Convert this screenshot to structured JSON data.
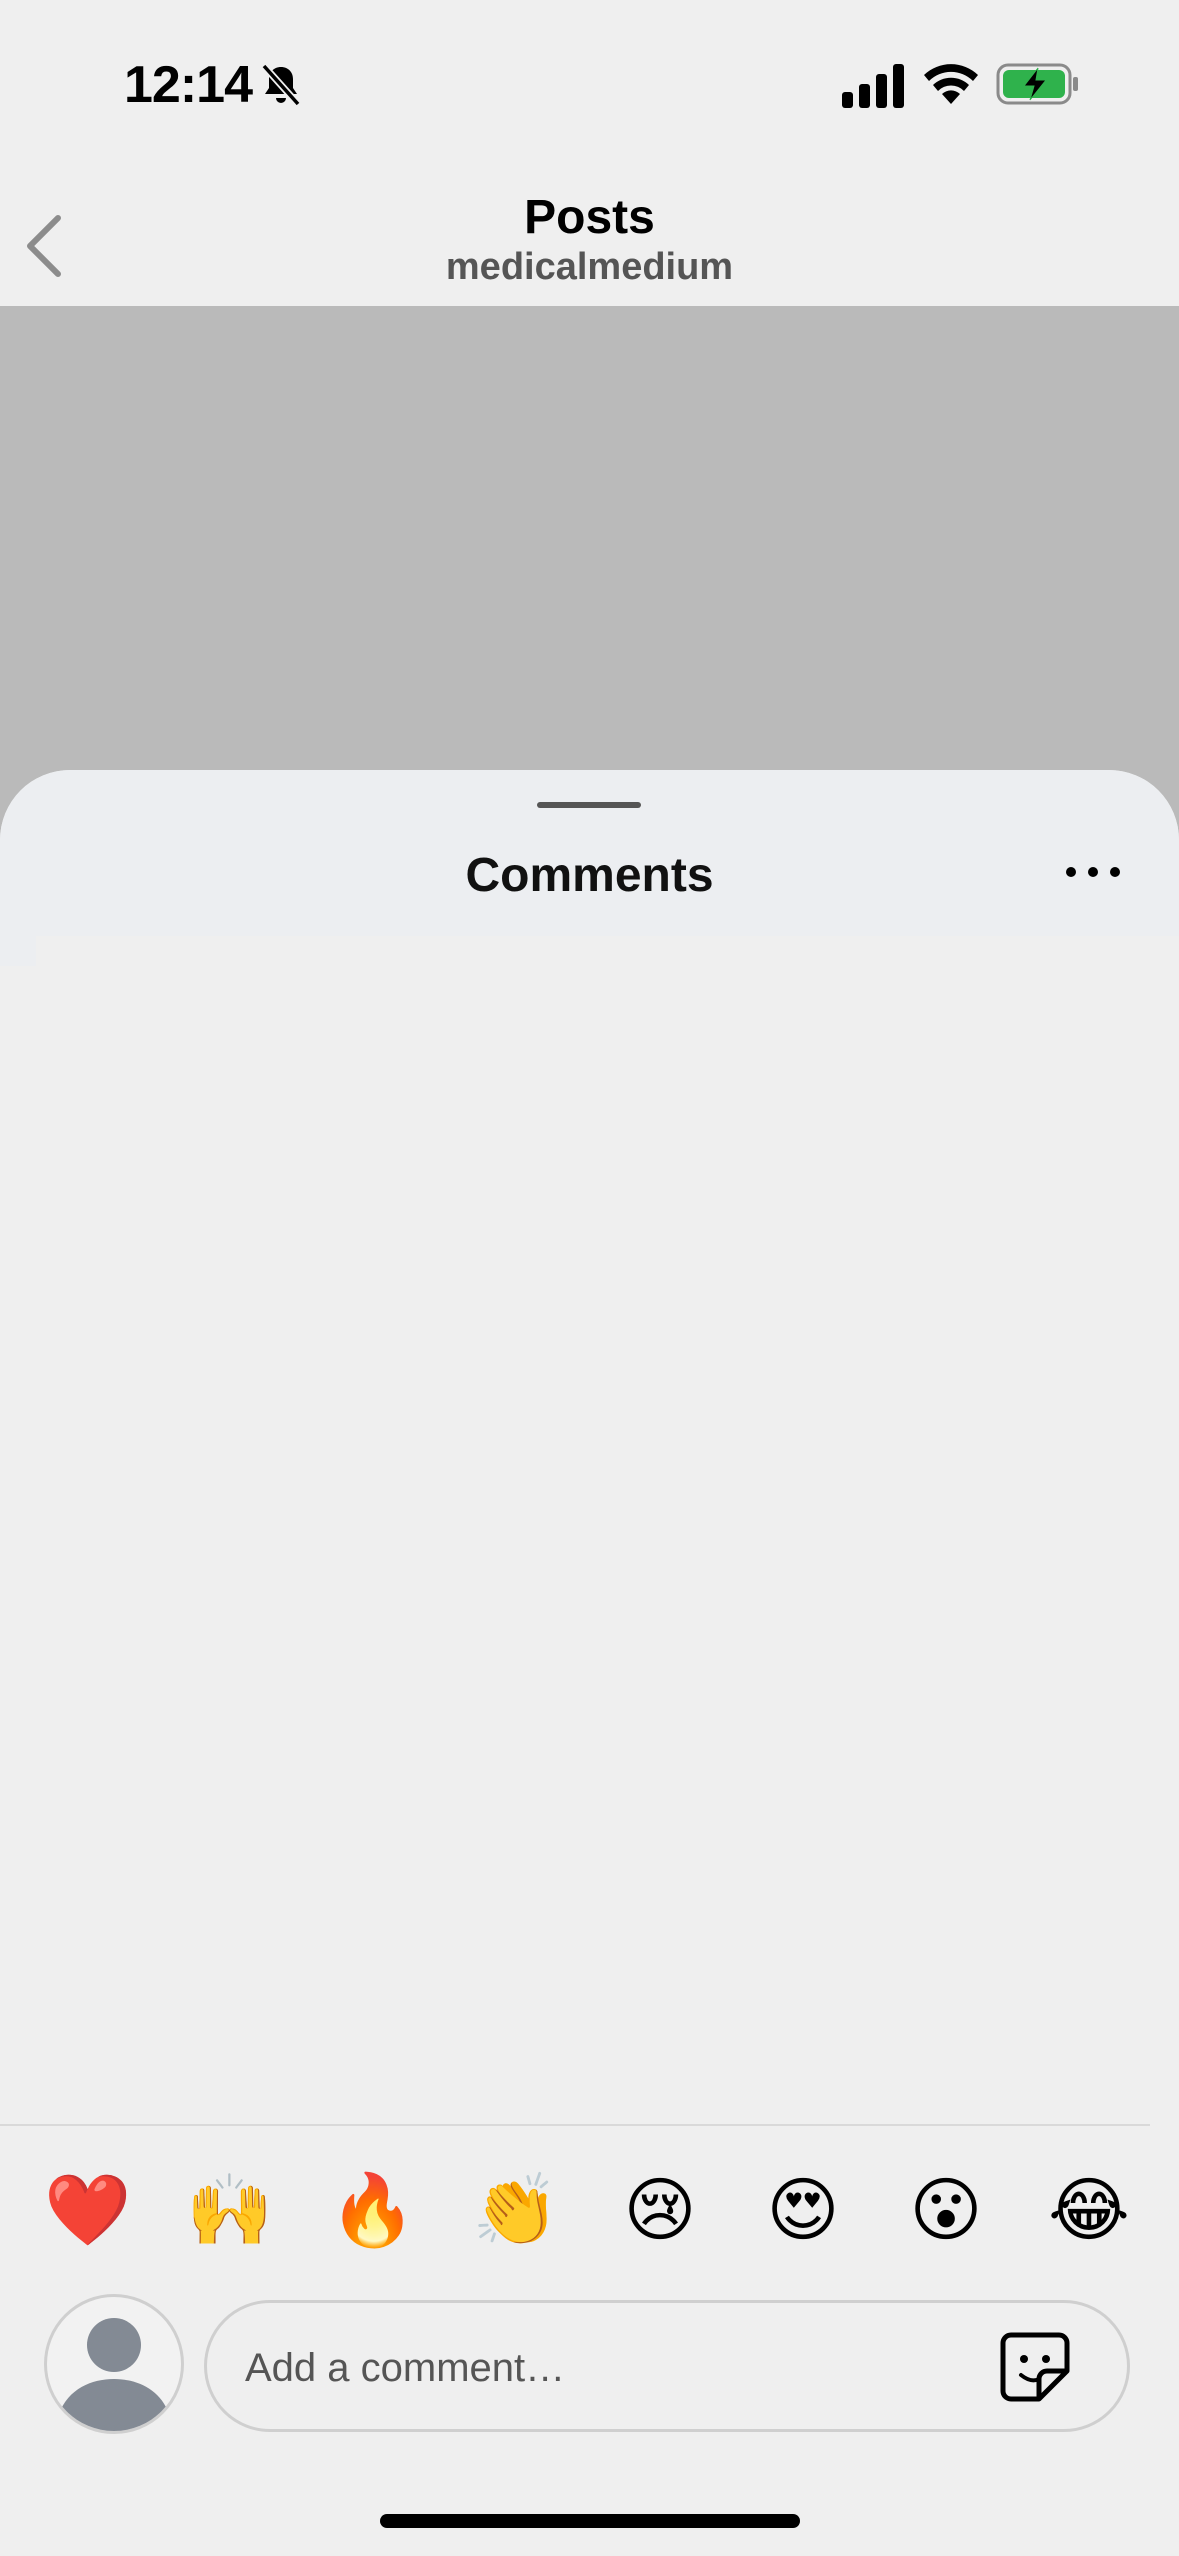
{
  "status_bar": {
    "time": "12:14",
    "icons": [
      "bell-slash-icon",
      "cellular-signal-icon",
      "wifi-icon",
      "battery-charging-icon"
    ],
    "battery_color": "#2fb24c"
  },
  "header": {
    "title": "Posts",
    "subtitle": "medicalmedium",
    "back_icon": "chevron-left-icon"
  },
  "sheet": {
    "title": "Comments",
    "more_icon": "more-horizontal-icon"
  },
  "emoji_bar": [
    {
      "name": "red-heart",
      "glyph": "❤️"
    },
    {
      "name": "raising-hands",
      "glyph": "🙌"
    },
    {
      "name": "fire",
      "glyph": "🔥"
    },
    {
      "name": "clapping-hands",
      "glyph": "👏"
    },
    {
      "name": "crying-face",
      "glyph": "😢"
    },
    {
      "name": "heart-eyes",
      "glyph": "😍"
    },
    {
      "name": "surprised-face",
      "glyph": "😮"
    },
    {
      "name": "tears-of-joy",
      "glyph": "😂"
    }
  ],
  "composer": {
    "placeholder": "Add a comment…",
    "avatar_icon": "default-avatar-icon",
    "sticker_icon": "sticker-icon"
  },
  "colors": {
    "background": "#efefef",
    "backdrop": "#bababa",
    "text_primary": "#000000",
    "text_secondary": "#555555"
  }
}
